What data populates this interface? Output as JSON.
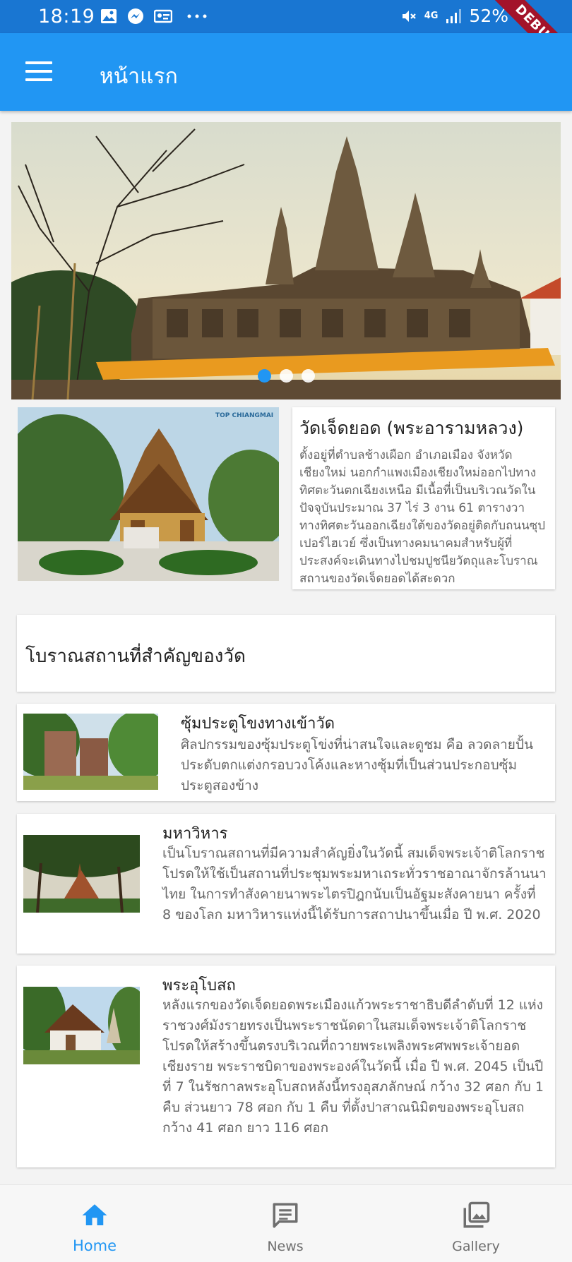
{
  "status_bar": {
    "time": "18:19",
    "network": "4G",
    "battery": "52%",
    "icons": [
      "image-icon",
      "messenger-icon",
      "id-icon",
      "more-dots-icon",
      "mute-icon",
      "signal-icon"
    ]
  },
  "debug_banner": "DEBUG",
  "app_bar": {
    "title": "หน้าแรก",
    "menu_icon": "hamburger-menu-icon"
  },
  "carousel": {
    "slide_count": 3,
    "active_index": 0
  },
  "feature": {
    "title": "วัดเจ็ดยอด (พระอารามหลวง)",
    "description": "ตั้งอยู่ที่ตำบลช้างเผือก อำเภอเมือง จังหวัดเชียงใหม่ นอกกำแพงเมืองเชียงใหม่ออกไปทางทิศตะวันตกเฉียงเหนือ มีเนื้อที่เป็นบริเวณวัดในปัจจุบันประมาณ 37 ไร่ 3 งาน 61 ตารางวา ทางทิศตะวันออกเฉียงใต้ของวัดอยู่ติดกับถนนซุปเปอร์ไฮเวย์ ซึ่งเป็นทางคมนาคมสำหรับผู้ที่ประสงค์จะเดินทางไปชมปูชนียวัตถุและโบราณสถานของวัดเจ็ดยอดได้สะดวก"
  },
  "section_header": "โบราณสถานที่สำคัญของวัด",
  "places": [
    {
      "title": "ซุ้มประตูโขงทางเข้าวัด",
      "description": "ศิลปกรรมของซุ้มประตูโข่งที่น่าสนใจและดูชม คือ ลวดลายปั้น ประดับตกแต่งกรอบวงโค้งและหางซุ้มที่เป็นส่วนประกอบซุ้มประตูสองข้าง"
    },
    {
      "title": "มหาวิหาร",
      "description": "เป็นโบราณสถานที่มีความสำคัญยิ่งในวัดนี้ สมเด็จพระเจ้าติโลกราชโปรดให้ใช้เป็นสถานที่ประชุมพระมหาเถระทั่วราชอาณาจักรล้านนาไทย ในการทำสังคายนาพระไตรปิฎกนับเป็นอัฐมะสังคายนา ครั้งที่ 8 ของโลก มหาวิหารแห่งนี้ได้รับการสถาปนาขึ้นเมื่อ ปี พ.ศ. 2020"
    },
    {
      "title": "พระอุโบสถ",
      "description": "หลังแรกของวัดเจ็ดยอดพระเมืองแก้วพระราชาธิบดีลำดับที่ 12 แห่งราชวงศ์มังรายทรงเป็นพระราชนัดดาในสมเด็จพระเจ้าติโลกราช โปรดให้สร้างขึ้นตรงบริเวณที่ถวายพระเพลิงพระศพพระเจ้ายอดเชียงราย พระราชบิดาของพระองค์ในวัดนี้ เมื่อ ปี พ.ศ. 2045 เป็นปีที่ 7 ในรัชกาลพระอุโบสถหลังนี้ทรงอุสภลักษณ์ กว้าง 32 ศอก กับ 1 คืบ ส่วนยาว 78 ศอก กับ 1 คืบ ที่ตั้งปาสาณนิมิตของพระอุโบสถ กว้าง 41 ศอก ยาว 116 ศอก"
    }
  ],
  "bottom_nav": {
    "items": [
      {
        "label": "Home",
        "icon": "home-icon",
        "active": true
      },
      {
        "label": "News",
        "icon": "news-icon",
        "active": false
      },
      {
        "label": "Gallery",
        "icon": "gallery-icon",
        "active": false
      }
    ]
  },
  "colors": {
    "primary": "#2196f3",
    "status_bar": "#1976d2",
    "debug_ribbon": "#a3132a",
    "background": "#f3f3f3"
  }
}
